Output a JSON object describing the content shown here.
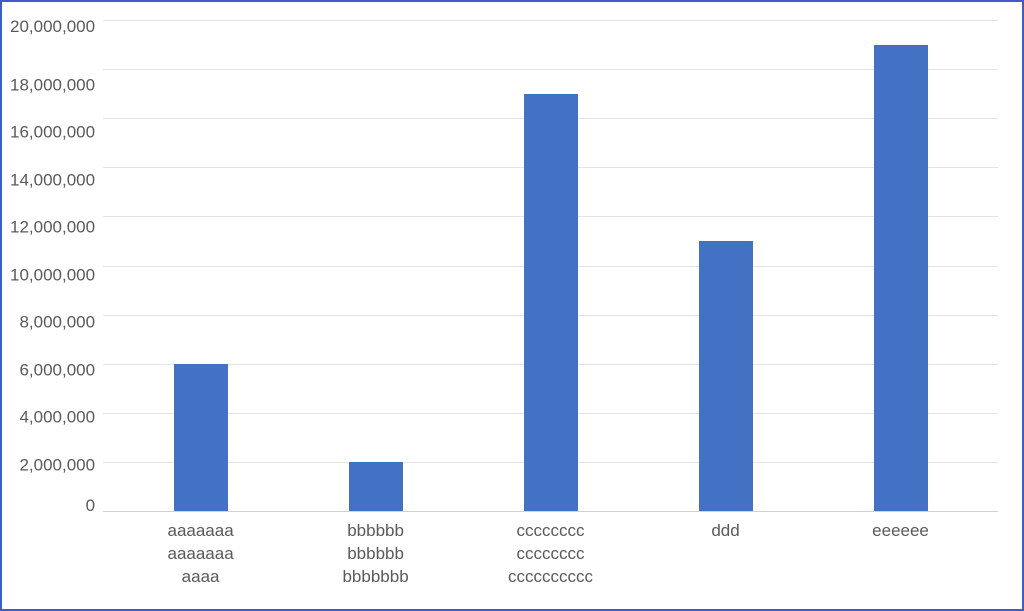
{
  "chart_data": {
    "type": "bar",
    "title": "",
    "xlabel": "",
    "ylabel": "",
    "ylim": [
      0,
      20000000
    ],
    "y_tick_step": 2000000,
    "y_ticks": [
      "20,000,000",
      "18,000,000",
      "16,000,000",
      "14,000,000",
      "12,000,000",
      "10,000,000",
      "8,000,000",
      "6,000,000",
      "4,000,000",
      "2,000,000",
      "0"
    ],
    "categories": [
      [
        "aaaaaaa",
        "aaaaaaa",
        "aaaa"
      ],
      [
        "bbbbbb",
        "bbbbbb",
        "bbbbbbb"
      ],
      [
        "cccccccc",
        "cccccccc",
        "cccccccccc"
      ],
      [
        "ddd"
      ],
      [
        "eeeeee"
      ]
    ],
    "values": [
      6000000,
      2000000,
      17000000,
      11000000,
      19000000
    ],
    "bar_color": "#4371c4",
    "gridline_color": "#e4e4e4",
    "axis_color": "#d1d1d1",
    "frame_border_color": "#3b5fc9"
  }
}
